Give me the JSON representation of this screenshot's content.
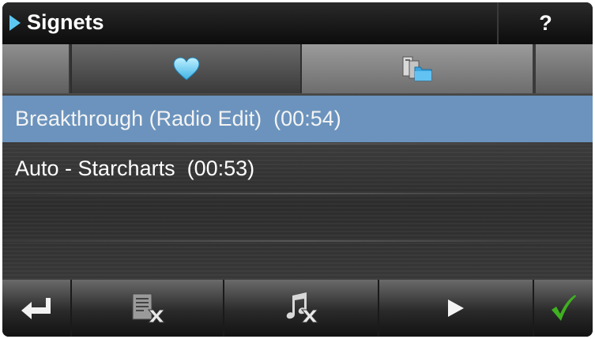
{
  "header": {
    "title": "Signets",
    "help_label": "?"
  },
  "tabs": [
    {
      "icon": "heart-icon",
      "active": true
    },
    {
      "icon": "folder-files-icon",
      "active": false
    }
  ],
  "bookmarks": [
    {
      "label": "Breakthrough (Radio Edit)  (00:54)",
      "selected": true
    },
    {
      "label": "Auto - Starcharts  (00:53)",
      "selected": false
    }
  ],
  "toolbar": [
    {
      "icon": "back-return-icon"
    },
    {
      "icon": "delete-list-icon"
    },
    {
      "icon": "delete-track-icon"
    },
    {
      "icon": "play-icon"
    },
    {
      "icon": "checkmark-icon"
    }
  ],
  "colors": {
    "accent": "#5cc8f0",
    "selection": "#6b93bd",
    "confirm": "#3fb020"
  }
}
